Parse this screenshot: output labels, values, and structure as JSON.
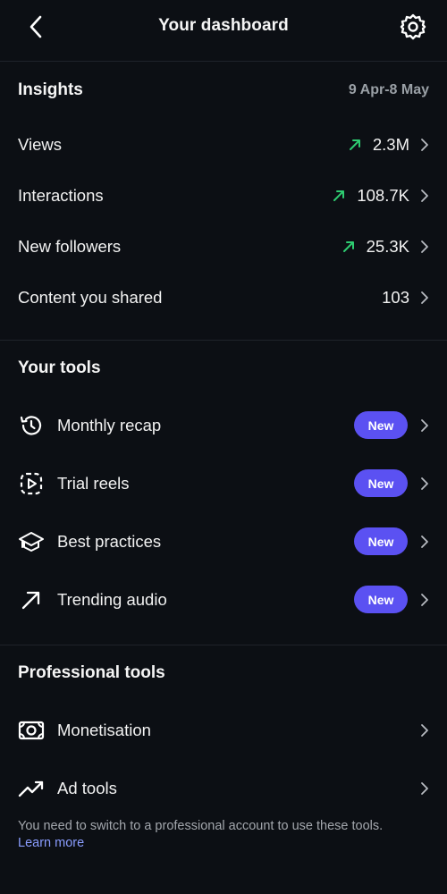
{
  "header": {
    "title": "Your dashboard",
    "back_icon": "chevron-left-icon",
    "settings_icon": "gear-icon"
  },
  "insights": {
    "title": "Insights",
    "date_range": "9 Apr-8 May",
    "rows": [
      {
        "label": "Views",
        "value": "2.3M",
        "trend": "up"
      },
      {
        "label": "Interactions",
        "value": "108.7K",
        "trend": "up"
      },
      {
        "label": "New followers",
        "value": "25.3K",
        "trend": "up"
      },
      {
        "label": "Content you shared",
        "value": "103",
        "trend": "none"
      }
    ]
  },
  "tools": {
    "title": "Your tools",
    "items": [
      {
        "label": "Monthly recap",
        "badge": "New",
        "icon": "history-icon"
      },
      {
        "label": "Trial reels",
        "badge": "New",
        "icon": "reels-dashed-icon"
      },
      {
        "label": "Best practices",
        "badge": "New",
        "icon": "graduation-cap-icon"
      },
      {
        "label": "Trending audio",
        "badge": "New",
        "icon": "arrow-up-right-icon"
      }
    ]
  },
  "professional": {
    "title": "Professional tools",
    "items": [
      {
        "label": "Monetisation",
        "icon": "money-icon"
      },
      {
        "label": "Ad tools",
        "icon": "trend-line-icon"
      }
    ],
    "note": "You need to switch to a professional account to use these tools.",
    "learn_more": "Learn more"
  },
  "colors": {
    "background": "#0c0f14",
    "trend_up": "#2ecc71",
    "badge": "#5b51f2",
    "link": "#8a9dff"
  }
}
